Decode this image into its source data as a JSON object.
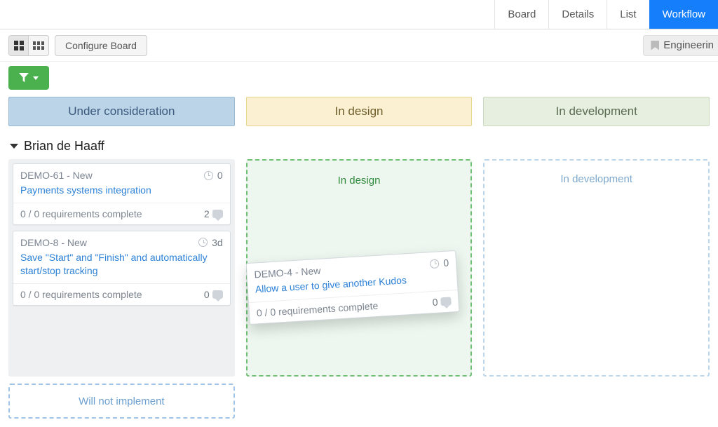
{
  "tabs": {
    "board": "Board",
    "details": "Details",
    "list": "List",
    "workflow": "Workflow",
    "active": "workflow"
  },
  "toolbar": {
    "configure": "Configure Board",
    "tag": "Engineerin"
  },
  "columns": {
    "under": "Under consideration",
    "design": "In design",
    "dev": "In development"
  },
  "swimlane": {
    "name": "Brian de Haaff"
  },
  "dropzones": {
    "wni": "Will not implement",
    "design": "In design",
    "dev": "In development"
  },
  "cards": {
    "c1": {
      "id": "DEMO-61 - New",
      "time": "0",
      "title": "Payments systems integration",
      "req": "0 / 0 requirements complete",
      "comments": "2"
    },
    "c2": {
      "id": "DEMO-8 - New",
      "time": "3d",
      "title": "Save \"Start\" and \"Finish\" and automatically start/stop tracking",
      "req": "0 / 0 requirements complete",
      "comments": "0"
    },
    "drag": {
      "id": "DEMO-4 - New",
      "time": "0",
      "title": "Allow a user to give another Kudos",
      "req": "0 / 0 requirements complete",
      "comments": "0"
    }
  }
}
